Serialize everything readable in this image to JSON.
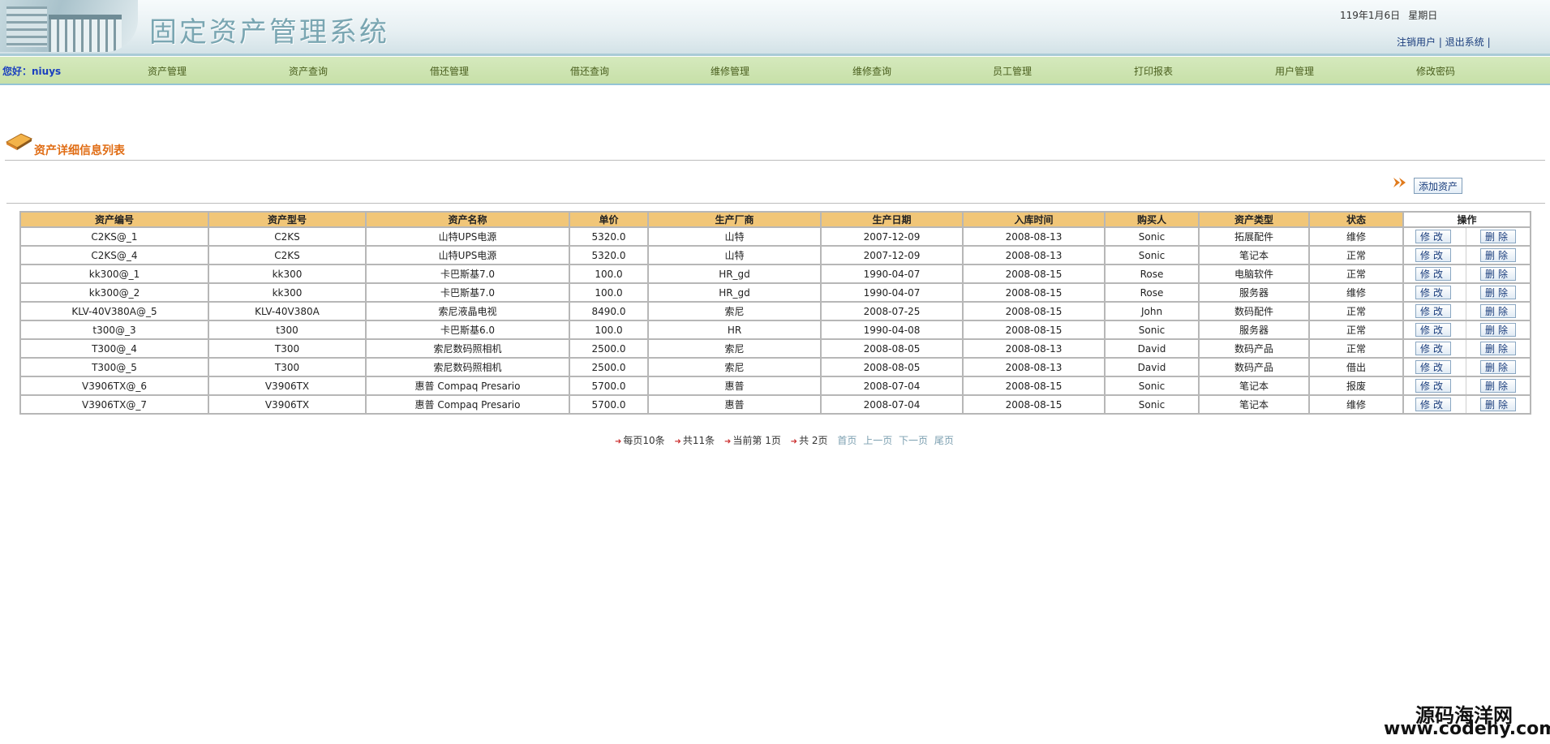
{
  "header": {
    "title": "固定资产管理系统",
    "date": "119年1月6日",
    "weekday": "星期日",
    "logout_user": "注销用户",
    "exit_system": "退出系统",
    "sep": "|"
  },
  "nav": {
    "greeting": "您好：niuys",
    "items": [
      "资产管理",
      "资产查询",
      "借还管理",
      "借还查询",
      "维修管理",
      "维修查询",
      "员工管理",
      "打印报表",
      "用户管理",
      "修改密码"
    ]
  },
  "section": {
    "title": "资产详细信息列表",
    "add_label": "添加资产"
  },
  "table": {
    "columns": [
      "资产编号",
      "资产型号",
      "资产名称",
      "单价",
      "生产厂商",
      "生产日期",
      "入库时间",
      "购买人",
      "资产类型",
      "状态",
      "操作"
    ],
    "edit_label": "修改",
    "delete_label": "删除",
    "rows": [
      [
        "C2KS@_1",
        "C2KS",
        "山特UPS电源",
        "5320.0",
        "山特",
        "2007-12-09",
        "2008-08-13",
        "Sonic",
        "拓展配件",
        "维修"
      ],
      [
        "C2KS@_4",
        "C2KS",
        "山特UPS电源",
        "5320.0",
        "山特",
        "2007-12-09",
        "2008-08-13",
        "Sonic",
        "笔记本",
        "正常"
      ],
      [
        "kk300@_1",
        "kk300",
        "卡巴斯基7.0",
        "100.0",
        "HR_gd",
        "1990-04-07",
        "2008-08-15",
        "Rose",
        "电脑软件",
        "正常"
      ],
      [
        "kk300@_2",
        "kk300",
        "卡巴斯基7.0",
        "100.0",
        "HR_gd",
        "1990-04-07",
        "2008-08-15",
        "Rose",
        "服务器",
        "维修"
      ],
      [
        "KLV-40V380A@_5",
        "KLV-40V380A",
        "索尼液晶电视",
        "8490.0",
        "索尼",
        "2008-07-25",
        "2008-08-15",
        "John",
        "数码配件",
        "正常"
      ],
      [
        "t300@_3",
        "t300",
        "卡巴斯基6.0",
        "100.0",
        "HR",
        "1990-04-08",
        "2008-08-15",
        "Sonic",
        "服务器",
        "正常"
      ],
      [
        "T300@_4",
        "T300",
        "索尼数码照相机",
        "2500.0",
        "索尼",
        "2008-08-05",
        "2008-08-13",
        "David",
        "数码产品",
        "正常"
      ],
      [
        "T300@_5",
        "T300",
        "索尼数码照相机",
        "2500.0",
        "索尼",
        "2008-08-05",
        "2008-08-13",
        "David",
        "数码产品",
        "借出"
      ],
      [
        "V3906TX@_6",
        "V3906TX",
        "惠普 Compaq Presario",
        "5700.0",
        "惠普",
        "2008-07-04",
        "2008-08-15",
        "Sonic",
        "笔记本",
        "报废"
      ],
      [
        "V3906TX@_7",
        "V3906TX",
        "惠普 Compaq Presario",
        "5700.0",
        "惠普",
        "2008-07-04",
        "2008-08-15",
        "Sonic",
        "笔记本",
        "维修"
      ]
    ]
  },
  "pager": {
    "per_page": "每页10条",
    "total": "共11条",
    "current": "当前第 1页",
    "pages": "共 2页",
    "first": "首页",
    "prev": "上一页",
    "next": "下一页",
    "last": "尾页"
  },
  "watermark": {
    "line1": "源码海洋网",
    "line2": "www.codehy.com"
  },
  "colors": {
    "nav_bg": "#cde4b0",
    "table_header": "#f1c678",
    "section_title": "#e06d15",
    "link": "#1a3d7c"
  }
}
